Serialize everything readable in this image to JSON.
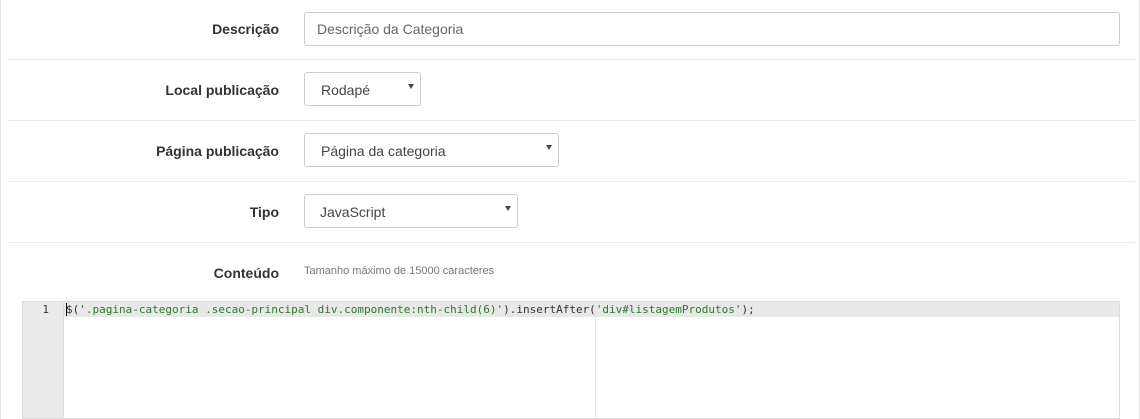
{
  "form": {
    "descricao": {
      "label": "Descrição",
      "placeholder": "Descrição da Categoria"
    },
    "local_publicacao": {
      "label": "Local publicação",
      "value": "Rodapé"
    },
    "pagina_publicacao": {
      "label": "Página publicação",
      "value": "Página da categoria"
    },
    "tipo": {
      "label": "Tipo",
      "value": "JavaScript"
    },
    "conteudo": {
      "label": "Conteúdo",
      "hint": "Tamanho máximo de 15000 caracteres"
    }
  },
  "editor": {
    "line_number": "1",
    "code": {
      "part1": "$(",
      "str1": "'.pagina-categoria .secao-principal div.componente:nth-child(6)'",
      "part2": ").insertAfter(",
      "str2": "'div#listagemProdutos'",
      "part3": ");"
    }
  },
  "icons": {
    "select_caret": "caret-down-icon"
  }
}
